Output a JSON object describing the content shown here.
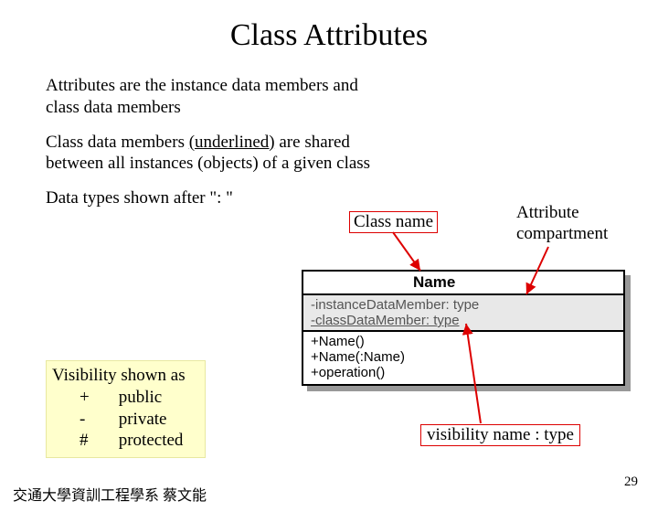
{
  "title": "Class Attributes",
  "para1": "Attributes are the instance data members and class data members",
  "para2a": "Class data members ",
  "para2u": "(underlined)",
  "para2b": " are shared between all instances (objects) of a given class",
  "para3": "Data types shown after \": \"",
  "visibility": {
    "heading": "Visibility shown as",
    "rows": [
      {
        "sym": "+",
        "name": "public"
      },
      {
        "sym": "-",
        "name": "private"
      },
      {
        "sym": "#",
        "name": "protected"
      }
    ]
  },
  "labels": {
    "classname": "Class name",
    "attr_compartment_l1": "Attribute",
    "attr_compartment_l2": "compartment",
    "vnt": "visibility name : type"
  },
  "uml": {
    "name": "Name",
    "attr1": "-instanceDataMember: type",
    "attr2": "-classDataMember: type",
    "op1": "+Name()",
    "op2": "+Name(:Name)",
    "op3": "+operation()"
  },
  "footer": "交通大學資訓工程學系 蔡文能",
  "page": "29"
}
